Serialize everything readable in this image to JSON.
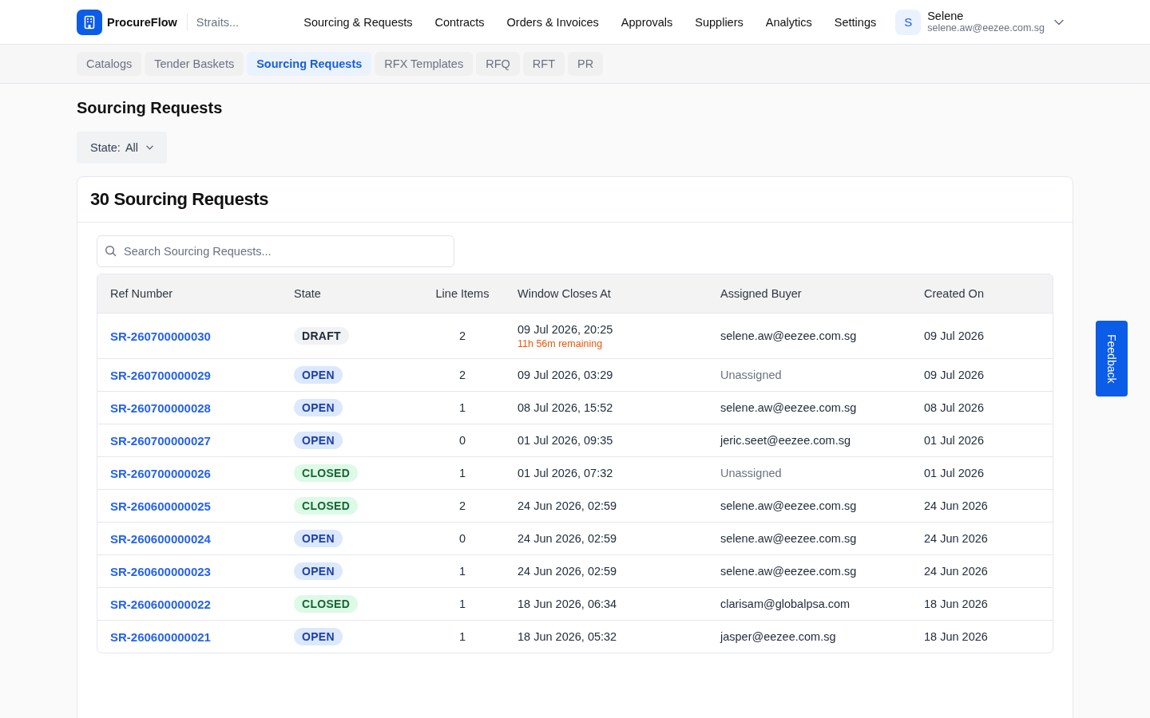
{
  "header": {
    "brand": "ProcureFlow",
    "organization": "Straits...",
    "nav": [
      {
        "label": "Sourcing & Requests",
        "selected": false
      },
      {
        "label": "Contracts",
        "selected": false
      },
      {
        "label": "Orders & Invoices",
        "selected": false
      },
      {
        "label": "Approvals",
        "selected": false
      },
      {
        "label": "Suppliers",
        "selected": false
      },
      {
        "label": "Analytics",
        "selected": false
      },
      {
        "label": "Settings",
        "selected": false
      }
    ],
    "user": {
      "initial": "S",
      "name": "Selene",
      "email": "selene.aw@eezee.com.sg"
    }
  },
  "subnav": {
    "tabs": [
      {
        "label": "Catalogs",
        "selected": false
      },
      {
        "label": "Tender Baskets",
        "selected": false
      },
      {
        "label": "Sourcing Requests",
        "selected": true
      },
      {
        "label": "RFX Templates",
        "selected": false
      },
      {
        "label": "RFQ",
        "selected": false
      },
      {
        "label": "RFT",
        "selected": false
      },
      {
        "label": "PR",
        "selected": false
      }
    ]
  },
  "page": {
    "title": "Sourcing Requests",
    "filter": {
      "label": "State:",
      "value": "All"
    }
  },
  "card": {
    "title": "30 Sourcing Requests",
    "search": {
      "placeholder": "Search Sourcing Requests..."
    },
    "table": {
      "columns": [
        "Ref Number",
        "State",
        "Line Items",
        "Window Closes At",
        "Assigned Buyer",
        "Created On"
      ],
      "rows": [
        {
          "ref": "SR-260700000030",
          "state": {
            "label": "DRAFT",
            "kind": "draft"
          },
          "line_items": "2",
          "window_closes_at": "09 Jul 2026, 20:25",
          "remaining": "11h 56m remaining",
          "buyer": {
            "text": "selene.aw@eezee.com.sg",
            "assigned": true
          },
          "created_on": "09 Jul 2026"
        },
        {
          "ref": "SR-260700000029",
          "state": {
            "label": "OPEN",
            "kind": "open"
          },
          "line_items": "2",
          "window_closes_at": "09 Jul 2026, 03:29",
          "buyer": {
            "text": "Unassigned",
            "assigned": false
          },
          "created_on": "09 Jul 2026"
        },
        {
          "ref": "SR-260700000028",
          "state": {
            "label": "OPEN",
            "kind": "open"
          },
          "line_items": "1",
          "window_closes_at": "08 Jul 2026, 15:52",
          "buyer": {
            "text": "selene.aw@eezee.com.sg",
            "assigned": true
          },
          "created_on": "08 Jul 2026"
        },
        {
          "ref": "SR-260700000027",
          "state": {
            "label": "OPEN",
            "kind": "open"
          },
          "line_items": "0",
          "window_closes_at": "01 Jul 2026, 09:35",
          "buyer": {
            "text": "jeric.seet@eezee.com.sg",
            "assigned": true
          },
          "created_on": "01 Jul 2026"
        },
        {
          "ref": "SR-260700000026",
          "state": {
            "label": "CLOSED",
            "kind": "closed"
          },
          "line_items": "1",
          "window_closes_at": "01 Jul 2026, 07:32",
          "buyer": {
            "text": "Unassigned",
            "assigned": false
          },
          "created_on": "01 Jul 2026"
        },
        {
          "ref": "SR-260600000025",
          "state": {
            "label": "CLOSED",
            "kind": "closed"
          },
          "line_items": "2",
          "window_closes_at": "24 Jun 2026, 02:59",
          "buyer": {
            "text": "selene.aw@eezee.com.sg",
            "assigned": true
          },
          "created_on": "24 Jun 2026"
        },
        {
          "ref": "SR-260600000024",
          "state": {
            "label": "OPEN",
            "kind": "open"
          },
          "line_items": "0",
          "window_closes_at": "24 Jun 2026, 02:59",
          "buyer": {
            "text": "selene.aw@eezee.com.sg",
            "assigned": true
          },
          "created_on": "24 Jun 2026"
        },
        {
          "ref": "SR-260600000023",
          "state": {
            "label": "OPEN",
            "kind": "open"
          },
          "line_items": "1",
          "window_closes_at": "24 Jun 2026, 02:59",
          "buyer": {
            "text": "selene.aw@eezee.com.sg",
            "assigned": true
          },
          "created_on": "24 Jun 2026"
        },
        {
          "ref": "SR-260600000022",
          "state": {
            "label": "CLOSED",
            "kind": "closed"
          },
          "line_items": "1",
          "window_closes_at": "18 Jun 2026, 06:34",
          "buyer": {
            "text": "clarisam@globalpsa.com",
            "assigned": true
          },
          "created_on": "18 Jun 2026"
        },
        {
          "ref": "SR-260600000021",
          "state": {
            "label": "OPEN",
            "kind": "open"
          },
          "line_items": "1",
          "window_closes_at": "18 Jun 2026, 05:32",
          "buyer": {
            "text": "jasper@eezee.com.sg",
            "assigned": true
          },
          "created_on": "18 Jun 2026"
        }
      ]
    }
  },
  "feedback": {
    "label": "Feedback"
  }
}
